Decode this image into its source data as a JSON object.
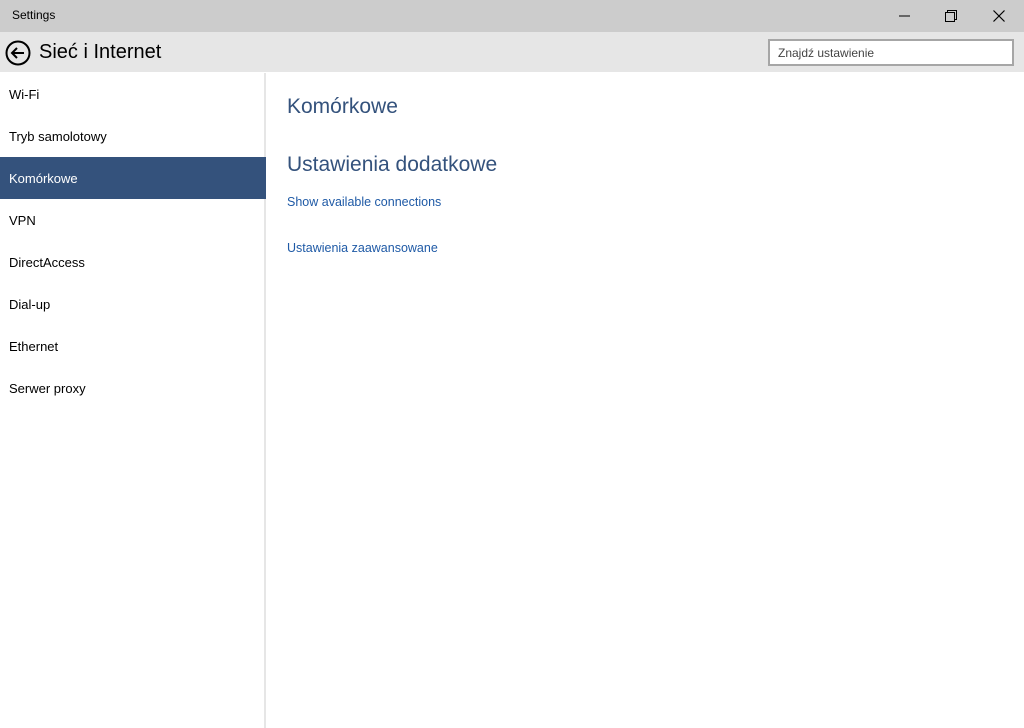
{
  "window": {
    "app_title": "Settings"
  },
  "header": {
    "title": "Sieć i Internet",
    "search_placeholder": "Znajdź ustawienie"
  },
  "sidebar": {
    "items": [
      {
        "label": "Wi-Fi",
        "active": false
      },
      {
        "label": "Tryb samolotowy",
        "active": false
      },
      {
        "label": "Komórkowe",
        "active": true
      },
      {
        "label": "VPN",
        "active": false
      },
      {
        "label": "DirectAccess",
        "active": false
      },
      {
        "label": "Dial-up",
        "active": false
      },
      {
        "label": "Ethernet",
        "active": false
      },
      {
        "label": "Serwer proxy",
        "active": false
      }
    ]
  },
  "main": {
    "section_title": "Komórkowe",
    "subsection_title": "Ustawienia dodatkowe",
    "links": [
      {
        "label": "Show available connections"
      },
      {
        "label": "Ustawienia zaawansowane"
      }
    ]
  },
  "colors": {
    "accent": "#34527c",
    "link": "#1f5aa6",
    "titlebar": "#cccccc",
    "header": "#e6e6e6"
  }
}
